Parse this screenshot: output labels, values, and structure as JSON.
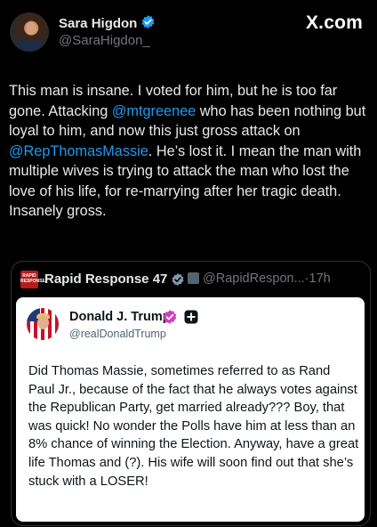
{
  "post": {
    "author_name": "Sara Higdon",
    "author_handle": "@SaraHigdon_",
    "brand": "X.com",
    "text_segments": [
      {
        "text": "This man is insane. I voted for him, but he is too far gone. Attacking ",
        "mention": false
      },
      {
        "text": "@mtgreenee",
        "mention": true
      },
      {
        "text": " who has been nothing but loyal to him, and now this just gross attack on ",
        "mention": false
      },
      {
        "text": "@RepThomasMassie",
        "mention": true
      },
      {
        "text": ". He’s lost it. I mean the man with multiple wives is trying to attack the man who lost the love of his life, for re-marrying after her tragic death. Insanely gross.",
        "mention": false
      }
    ]
  },
  "quoted": {
    "author_name": "Rapid Response 47",
    "author_handle": "@RapidRespon...",
    "separator": "·",
    "time": "17h",
    "logo_text": "RAPID RESPONSE"
  },
  "embedded": {
    "author_name": "Donald J. Trump",
    "author_handle": "@realDonaldTrump",
    "text": "Did Thomas Massie, sometimes referred to as Rand Paul Jr., because of the fact that he always votes against the Republican Party, get married already??? Boy, that was quick! No wonder the Polls have him at less than an 8% chance of winning the Election. Anyway, have a great life Thomas and (?). His wife will soon find out that she’s stuck with a LOSER!"
  },
  "colors": {
    "background": "#000000",
    "mention": "#1d9bf0",
    "verified_blue": "#1d9bf0",
    "truth_social_purple": "#cf3ec2"
  },
  "icons": [
    "verified-badge-icon",
    "government-badge-icon",
    "truth-verified-icon",
    "add-icon"
  ]
}
